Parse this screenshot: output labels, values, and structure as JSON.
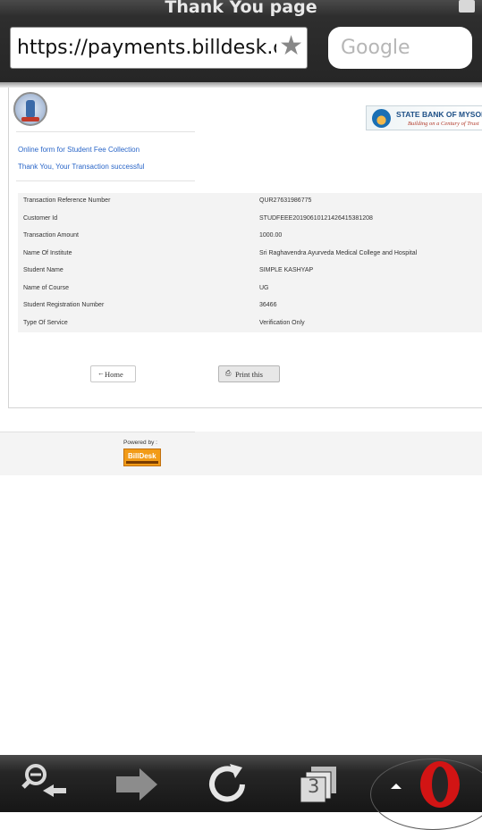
{
  "browser": {
    "window_title": "Thank You page",
    "url": "https://payments.billdesk.c",
    "search_placeholder": "Google",
    "tab_count": "3"
  },
  "page": {
    "header": {
      "bank_name": "STATE BANK OF MYSORE",
      "bank_tagline": "Building on a Century of Trust"
    },
    "form_title": "Online  form  for  Student  Fee  Collection",
    "success_message": "Thank  You,  Your  Transaction  successful",
    "details": [
      {
        "label": "Transaction  Reference  Number",
        "value": "QUR27631986775"
      },
      {
        "label": "Customer  Id",
        "value": "STUDFEEE20190610121426415381208"
      },
      {
        "label": "Transaction  Amount",
        "value": "1000.00"
      },
      {
        "label": "Name  Of  Institute",
        "value": "Sri  Raghavendra   Ayurveda   Medical  College  and  Hospital"
      },
      {
        "label": "Student  Name",
        "value": "SIMPLE   KASHYAP"
      },
      {
        "label": "Name  of  Course",
        "value": "UG"
      },
      {
        "label": "Student  Registration   Number",
        "value": "36466"
      },
      {
        "label": "Type  Of  Service",
        "value": "Verification   Only"
      }
    ],
    "buttons": {
      "home_label": "Home",
      "print_label": "Print this"
    },
    "footer": {
      "powered_by": "Powered by :",
      "billdesk_logo_text": "BillDesk"
    }
  },
  "colors": {
    "link_blue": "#2a66c8",
    "billdesk_orange": "#f29b17",
    "opera_red": "#d21414"
  }
}
